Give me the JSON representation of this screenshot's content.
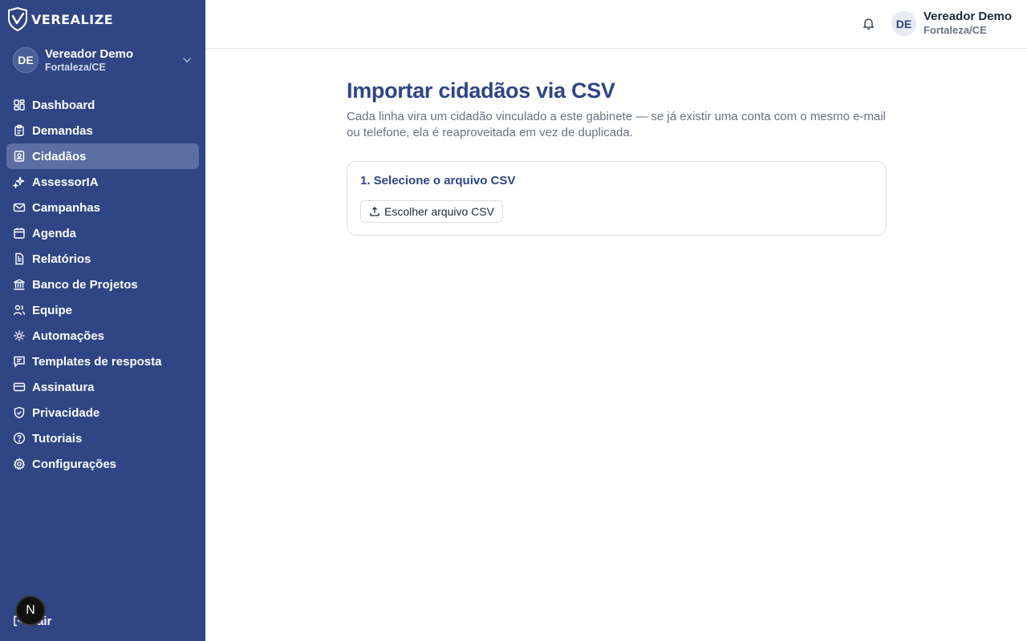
{
  "brand": {
    "name": "VEREALIZE"
  },
  "account": {
    "initials": "DE",
    "name": "Vereador Demo",
    "city": "Fortaleza/CE"
  },
  "nav": [
    {
      "label": "Dashboard",
      "icon": "dashboard-icon"
    },
    {
      "label": "Demandas",
      "icon": "clipboard-icon"
    },
    {
      "label": "Cidadãos",
      "icon": "contact-icon",
      "active": true
    },
    {
      "label": "AssessorIA",
      "icon": "sparkles-icon"
    },
    {
      "label": "Campanhas",
      "icon": "mail-icon"
    },
    {
      "label": "Agenda",
      "icon": "calendar-icon"
    },
    {
      "label": "Relatórios",
      "icon": "file-text-icon"
    },
    {
      "label": "Banco de Projetos",
      "icon": "landmark-icon"
    },
    {
      "label": "Equipe",
      "icon": "users-icon"
    },
    {
      "label": "Automações",
      "icon": "cog-icon"
    },
    {
      "label": "Templates de resposta",
      "icon": "message-square-icon"
    },
    {
      "label": "Assinatura",
      "icon": "credit-card-icon"
    },
    {
      "label": "Privacidade",
      "icon": "shield-check-icon"
    },
    {
      "label": "Tutoriais",
      "icon": "help-circle-icon"
    },
    {
      "label": "Configurações",
      "icon": "settings-icon"
    }
  ],
  "logout": {
    "label": "Sair"
  },
  "dev_badge": {
    "letter": "N"
  },
  "header": {
    "initials": "DE",
    "name": "Vereador Demo",
    "city": "Fortaleza/CE"
  },
  "main": {
    "title": "Importar cidadãos via CSV",
    "description": "Cada linha vira um cidadão vinculado a este gabinete — se já existir uma conta com o mesmo e-mail ou telefone, ela é reaproveitada em vez de duplicada.",
    "step1": {
      "title": "1. Selecione o arquivo CSV",
      "button_label": "Escolher arquivo CSV"
    }
  },
  "colors": {
    "sidebar": "#2f4584",
    "accent": "#2f4584",
    "active_item": "#5b6fa4"
  }
}
